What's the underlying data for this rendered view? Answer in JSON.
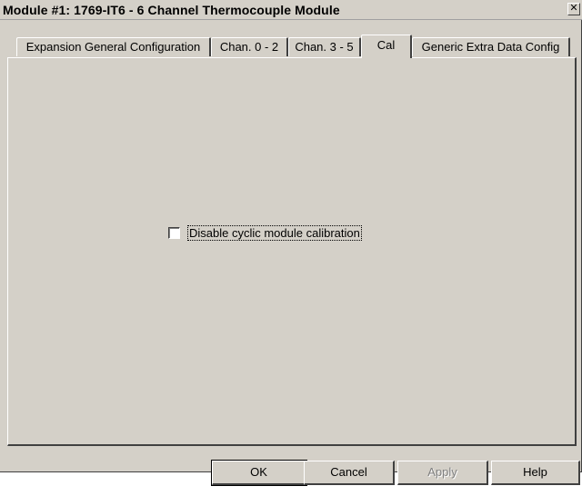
{
  "window": {
    "title": "Module #1: 1769-IT6 - 6 Channel Thermocouple Module",
    "close_glyph": "✕"
  },
  "tabs": [
    {
      "label": "Expansion General Configuration",
      "active": false
    },
    {
      "label": "Chan. 0 - 2",
      "active": false
    },
    {
      "label": "Chan. 3 - 5",
      "active": false
    },
    {
      "label": "Cal",
      "active": true
    },
    {
      "label": "Generic Extra Data Config",
      "active": false
    }
  ],
  "cal_tab": {
    "disable_cyclic_calibration": {
      "label": "Disable cyclic module calibration",
      "checked": false
    }
  },
  "buttons": {
    "ok": "OK",
    "cancel": "Cancel",
    "apply": "Apply",
    "help": "Help"
  }
}
